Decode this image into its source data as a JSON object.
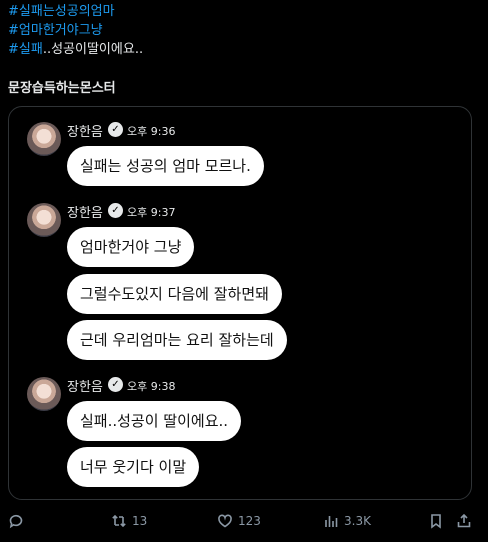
{
  "hashtags": [
    {
      "tag": "#실패는성공의엄마",
      "rest": ""
    },
    {
      "tag": "#엄마한거야그냥",
      "rest": ""
    },
    {
      "tag": "#실패",
      "rest": "..성공이딸이에요.."
    }
  ],
  "heading": "문장습득하는몬스터",
  "groups": [
    {
      "name": "장한음",
      "time": "오후 9:36",
      "messages": [
        "실패는 성공의 엄마 모르나."
      ]
    },
    {
      "name": "장한음",
      "time": "오후 9:37",
      "messages": [
        "엄마한거야 그냥",
        "그럴수도있지 다음에 잘하면돼",
        "근데 우리엄마는 요리 잘하는데"
      ]
    },
    {
      "name": "장한음",
      "time": "오후 9:38",
      "messages": [
        "실패..성공이 딸이에요..",
        "너무 웃기다 이말"
      ]
    }
  ],
  "actions": {
    "reply_icon": "reply-icon",
    "retweets": "13",
    "likes": "123",
    "views": "3.3K"
  }
}
